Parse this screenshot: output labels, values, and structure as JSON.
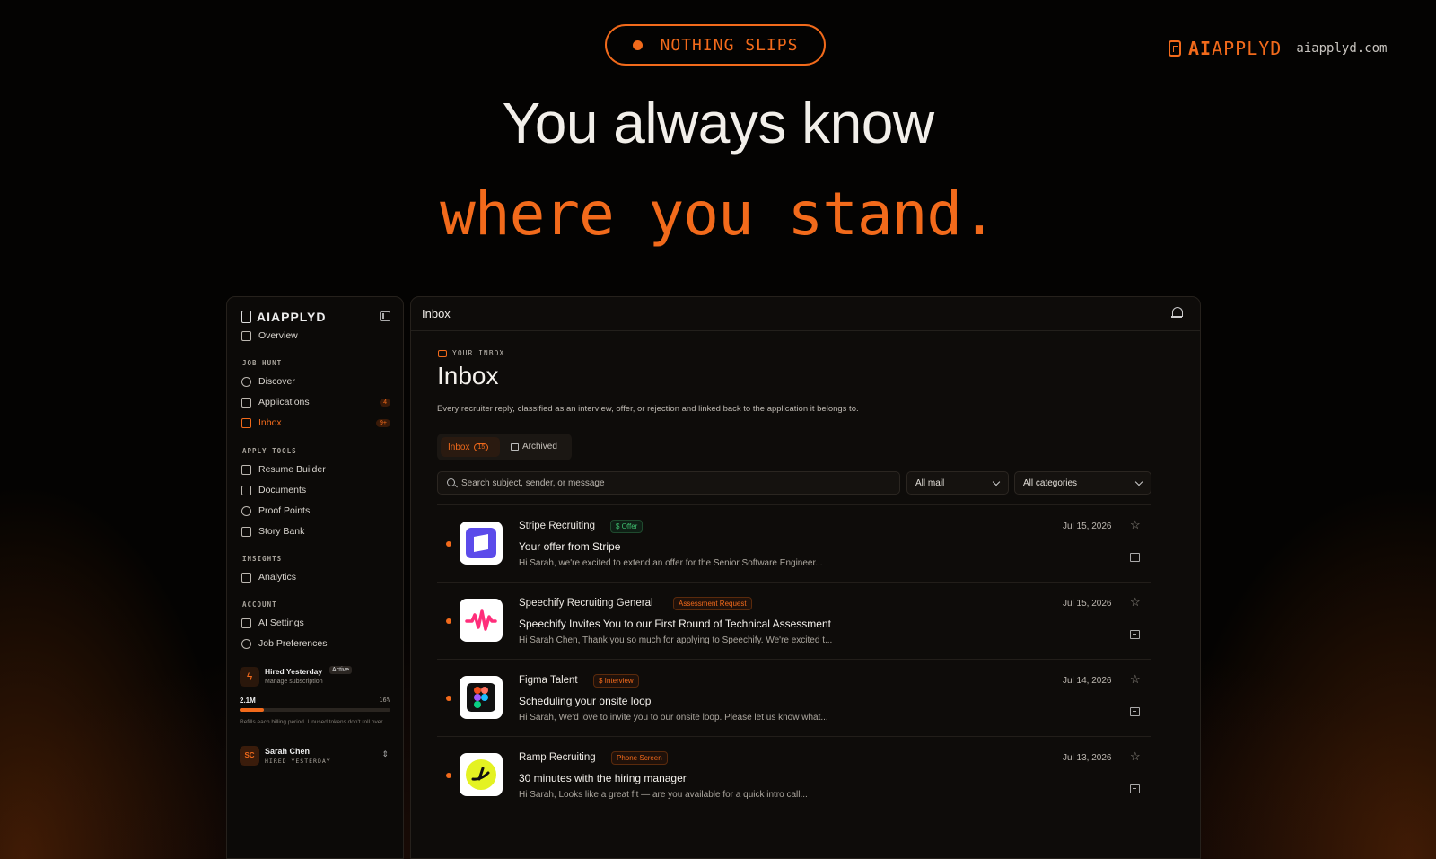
{
  "hero": {
    "pill_text": "NOTHING SLIPS",
    "brand_bold": "AI",
    "brand_rest": "APPLYD",
    "brand_url": "aiapplyd.com",
    "headline": "You always know",
    "headline_accent": "where you stand."
  },
  "sidebar": {
    "brand": "AIAPPLYD",
    "overview": "Overview",
    "sections": {
      "job_hunt": "JOB HUNT",
      "apply_tools": "APPLY TOOLS",
      "insights": "INSIGHTS",
      "account": "ACCOUNT"
    },
    "items": {
      "discover": "Discover",
      "applications": "Applications",
      "applications_badge": "4",
      "inbox": "Inbox",
      "inbox_badge": "9+",
      "resume_builder": "Resume Builder",
      "documents": "Documents",
      "proof_points": "Proof Points",
      "story_bank": "Story Bank",
      "analytics": "Analytics",
      "ai_settings": "AI Settings",
      "job_preferences": "Job Preferences"
    },
    "plan": {
      "name": "Hired Yesterday",
      "status": "Active",
      "sub": "Manage subscription",
      "tokens": "2.1M",
      "percent_label": "16%",
      "used_fraction": 0.16,
      "refill_note": "Refills each billing period. Unused tokens don't roll over."
    },
    "user": {
      "initials": "SC",
      "name": "Sarah Chen",
      "role": "HIRED YESTERDAY"
    }
  },
  "main": {
    "topbar_title": "Inbox",
    "eyebrow": "YOUR INBOX",
    "title": "Inbox",
    "description": "Every recruiter reply, classified as an interview, offer, or rejection and linked back to the application it belongs to.",
    "tabs": {
      "inbox_label": "Inbox",
      "inbox_count": "15",
      "archived_label": "Archived"
    },
    "search_placeholder": "Search subject, sender, or message",
    "filter_mail": "All mail",
    "filter_category": "All categories"
  },
  "colors": {
    "accent": "#f26a1b",
    "offer": "#3fbf6f",
    "background": "#050403"
  },
  "messages": [
    {
      "sender": "Stripe Recruiting",
      "tag": "$ Offer",
      "subject": "Your offer from Stripe",
      "preview": "Hi Sarah, we're excited to extend an offer for the Senior Software Engineer...",
      "date": "Jul 15, 2026",
      "logo": "stripe-logo"
    },
    {
      "sender": "Speechify Recruiting General",
      "tag": "Assessment Request",
      "subject": "Speechify Invites You to our First Round of Technical Assessment",
      "preview": "Hi Sarah Chen, Thank you so much for applying to Speechify. We're excited t...",
      "date": "Jul 15, 2026",
      "logo": "speechify-logo"
    },
    {
      "sender": "Figma Talent",
      "tag": "$ Interview",
      "subject": "Scheduling your onsite loop",
      "preview": "Hi Sarah, We'd love to invite you to our onsite loop. Please let us know what...",
      "date": "Jul 14, 2026",
      "logo": "figma-logo"
    },
    {
      "sender": "Ramp Recruiting",
      "tag": "Phone Screen",
      "subject": "30 minutes with the hiring manager",
      "preview": "Hi Sarah, Looks like a great fit — are you available for a quick intro call...",
      "date": "Jul 13, 2026",
      "logo": "ramp-logo"
    }
  ]
}
